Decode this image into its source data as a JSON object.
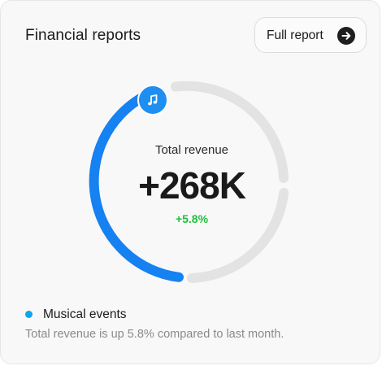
{
  "card": {
    "title": "Financial reports",
    "report_button_label": "Full report",
    "report_button_icon": "arrow-right-icon"
  },
  "summary": {
    "label": "Total revenue",
    "value": "+268K",
    "change": "+5.8%",
    "change_color": "#1fbf3a"
  },
  "progress_ring": {
    "segments": [
      {
        "name": "Musical events",
        "fraction": 0.4,
        "color": "#1681f0"
      },
      {
        "name": "remainder",
        "fraction": 0.6,
        "color": "#e3e3e3"
      }
    ],
    "badge_icon": "music-note-icon"
  },
  "legend": {
    "items": [
      {
        "label": "Musical events",
        "color": "#0ea5f0"
      }
    ]
  },
  "footnote": "Total revenue is up 5.8% compared to last month."
}
